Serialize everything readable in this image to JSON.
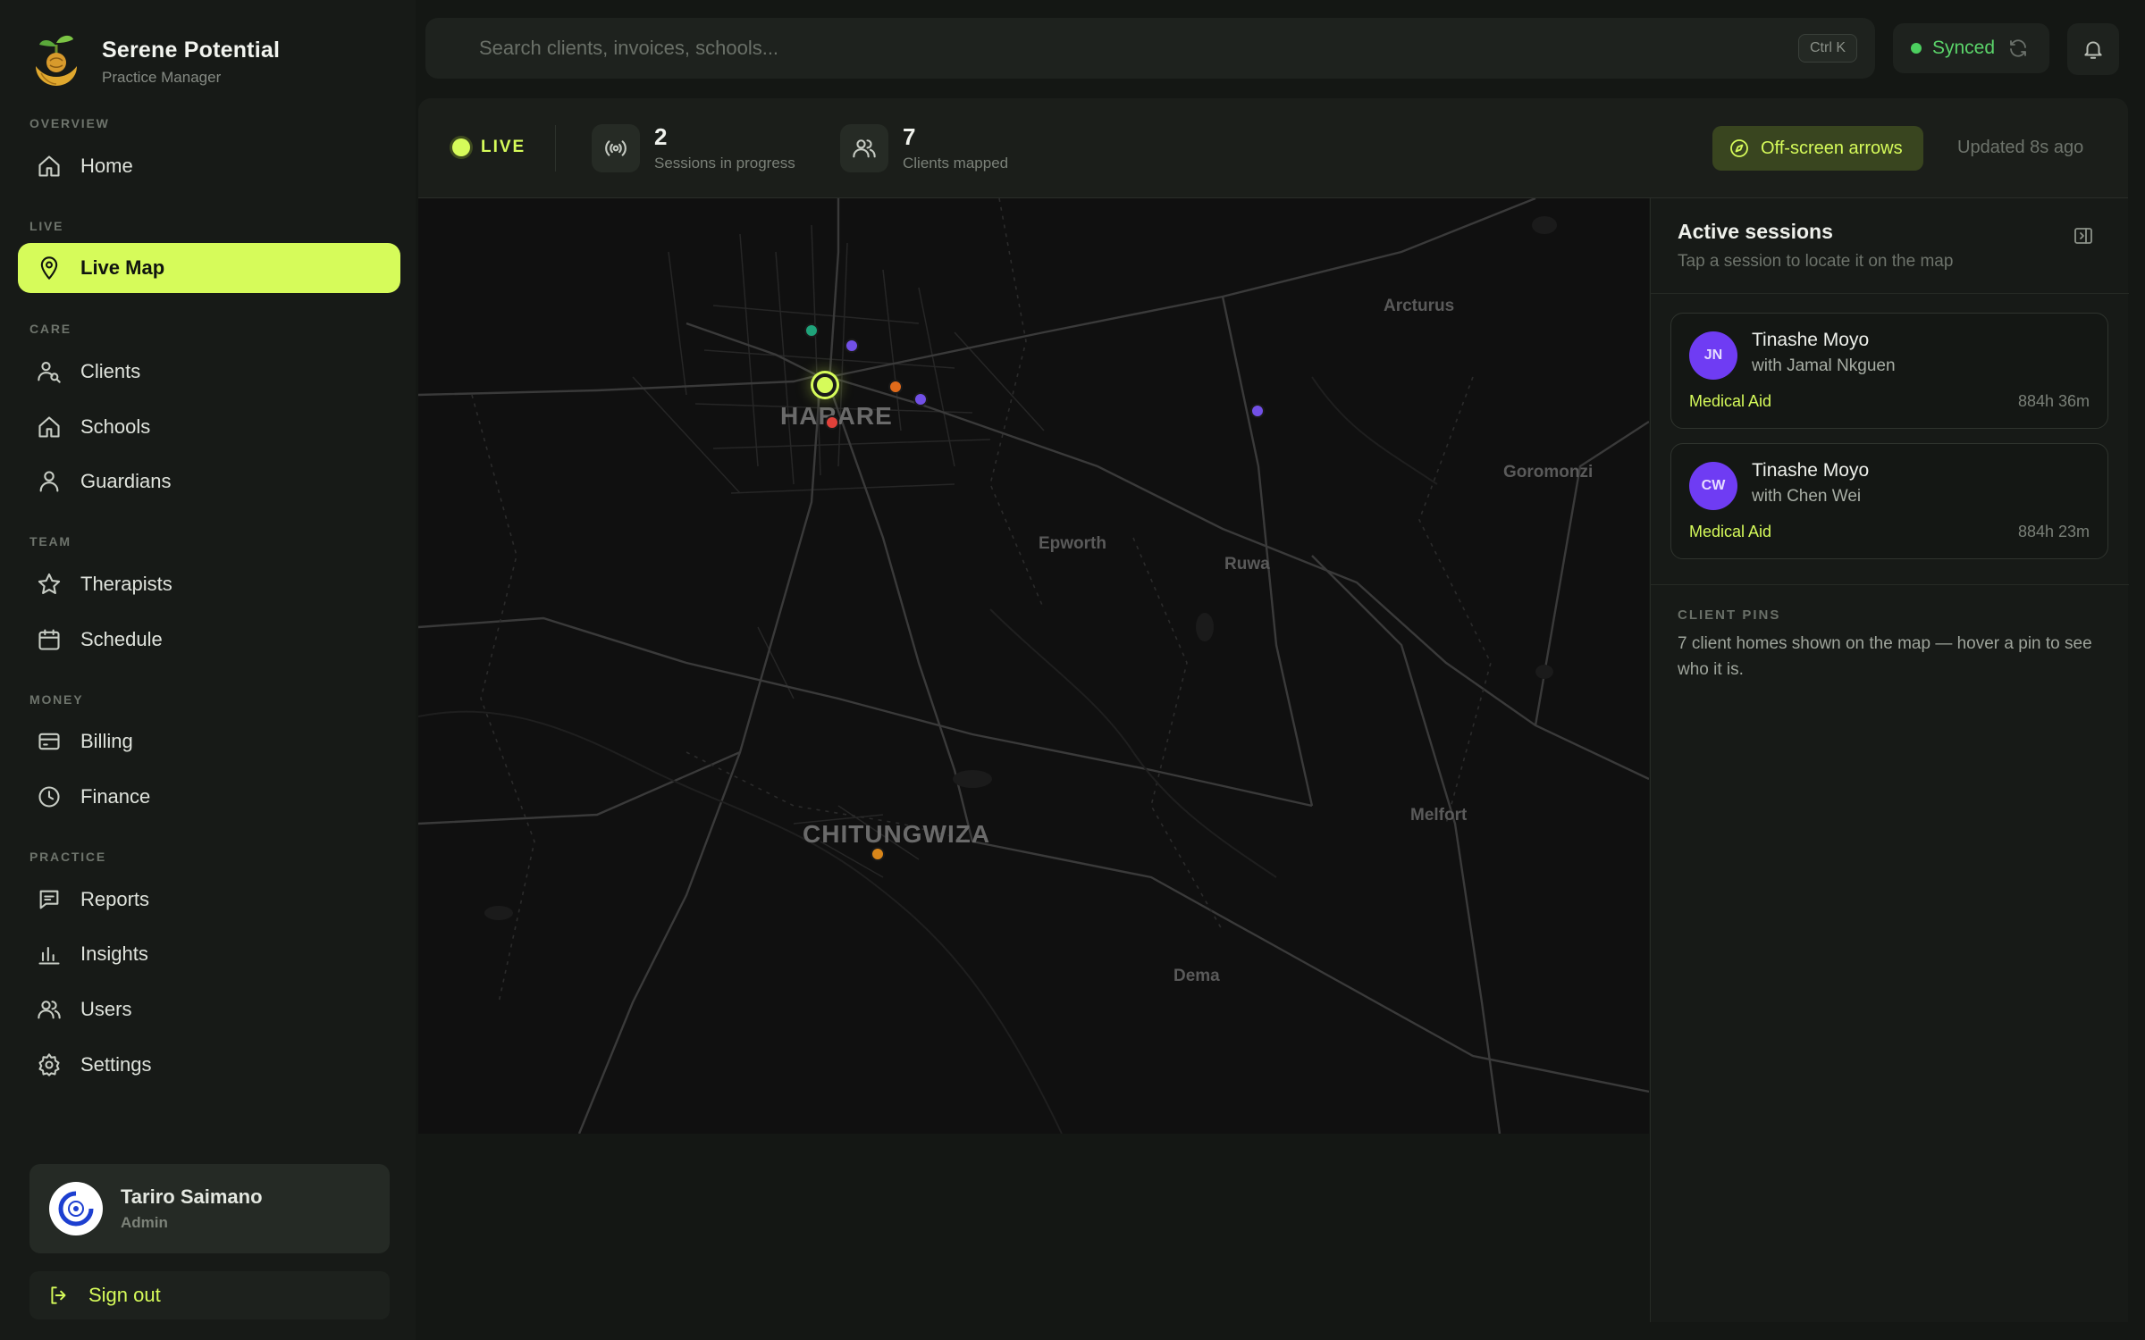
{
  "brand": {
    "name": "Serene Potential",
    "subtitle": "Practice Manager"
  },
  "nav": {
    "sections": {
      "overview": "OVERVIEW",
      "live": "LIVE",
      "care": "CARE",
      "team": "TEAM",
      "money": "MONEY",
      "practice": "PRACTICE"
    },
    "items": {
      "home": "Home",
      "live_map": "Live Map",
      "clients": "Clients",
      "schools": "Schools",
      "guardians": "Guardians",
      "therapists": "Therapists",
      "schedule": "Schedule",
      "billing": "Billing",
      "finance": "Finance",
      "reports": "Reports",
      "insights": "Insights",
      "users": "Users",
      "settings": "Settings"
    },
    "active": "live_map"
  },
  "user": {
    "name": "Tariro Saimano",
    "role": "Admin"
  },
  "signout_label": "Sign out",
  "search": {
    "placeholder": "Search clients, invoices, schools...",
    "value": "",
    "shortcut": "Ctrl K"
  },
  "sync": {
    "label": "Synced"
  },
  "status": {
    "live_label": "LIVE",
    "sessions_count": "2",
    "sessions_label": "Sessions in progress",
    "clients_count": "7",
    "clients_label": "Clients mapped",
    "offscreen_label": "Off-screen arrows",
    "updated": "Updated 8s ago"
  },
  "map": {
    "labels": {
      "harare": "HARARE",
      "chitungwiza": "CHITUNGWIZA",
      "arcturus": "Arcturus",
      "goromonzi": "Goromonzi",
      "epworth": "Epworth",
      "ruwa": "Ruwa",
      "melfort": "Melfort",
      "dema": "Dema"
    },
    "pin_colors": {
      "green": "#1fa37a",
      "purple": "#7250e6",
      "orange": "#e06a1a",
      "red": "#e0413a",
      "amber": "#d9861a",
      "live": "#d6fb5a"
    }
  },
  "panel": {
    "title": "Active sessions",
    "subtitle": "Tap a session to locate it on the map",
    "sessions": [
      {
        "initials": "JN",
        "therapist": "Tinashe Moyo",
        "with": "with Jamal Nkguen",
        "tag": "Medical Aid",
        "duration": "884h 36m"
      },
      {
        "initials": "CW",
        "therapist": "Tinashe Moyo",
        "with": "with Chen Wei",
        "tag": "Medical Aid",
        "duration": "884h 23m"
      }
    ],
    "pins_heading": "CLIENT PINS",
    "pins_text": "7 client homes shown on the map — hover a pin to see who it is."
  }
}
